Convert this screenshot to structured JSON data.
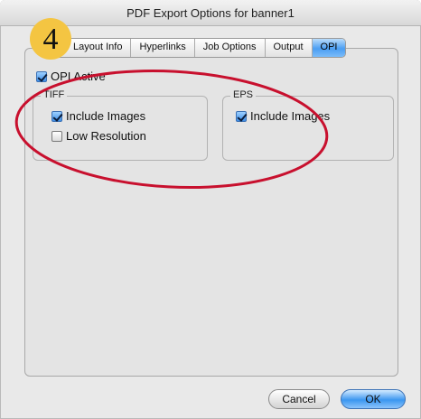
{
  "window": {
    "title": "PDF Export Options for banner1"
  },
  "step_badge": "4",
  "tabs": [
    {
      "label": "Layout Info",
      "active": false
    },
    {
      "label": "Hyperlinks",
      "active": false
    },
    {
      "label": "Job Options",
      "active": false
    },
    {
      "label": "Output",
      "active": false
    },
    {
      "label": "OPI",
      "active": true
    }
  ],
  "opi_active": {
    "label": "OPI Active",
    "checked": true
  },
  "tiff": {
    "label": "TIFF",
    "include_images": {
      "label": "Include Images",
      "checked": true
    },
    "low_resolution": {
      "label": "Low Resolution",
      "checked": false
    }
  },
  "eps": {
    "label": "EPS",
    "include_images": {
      "label": "Include Images",
      "checked": true
    }
  },
  "buttons": {
    "cancel": "Cancel",
    "ok": "OK"
  },
  "colors": {
    "annotation_circle": "#c8102e",
    "badge": "#f4c542",
    "accent": "#3b96f0"
  }
}
